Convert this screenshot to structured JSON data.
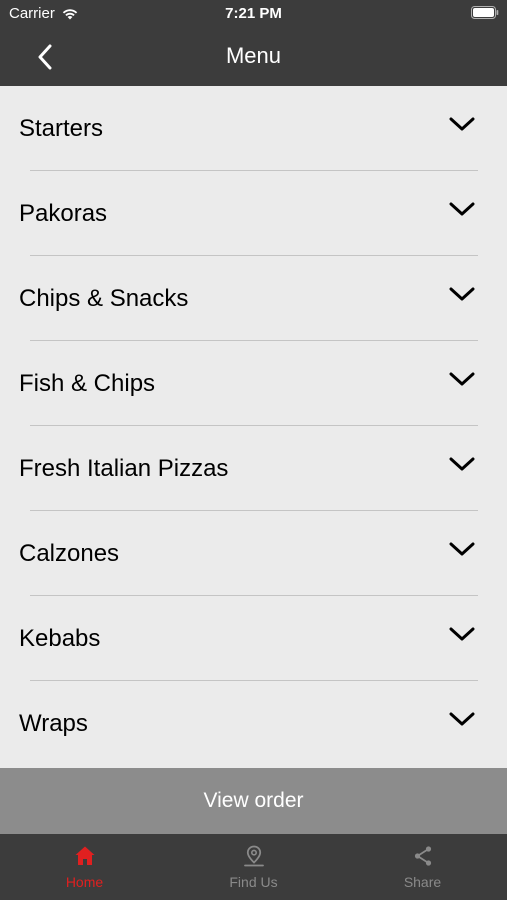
{
  "status_bar": {
    "carrier": "Carrier",
    "time": "7:21 PM",
    "wifi_icon": "wifi-icon",
    "battery_icon": "battery-icon"
  },
  "nav": {
    "title": "Menu",
    "back_icon": "chevron-left-icon"
  },
  "menu": {
    "items": [
      {
        "label": "Starters"
      },
      {
        "label": "Pakoras"
      },
      {
        "label": "Chips & Snacks"
      },
      {
        "label": "Fish & Chips"
      },
      {
        "label": "Fresh Italian Pizzas"
      },
      {
        "label": "Calzones"
      },
      {
        "label": "Kebabs"
      },
      {
        "label": "Wraps"
      }
    ],
    "expand_icon": "chevron-down-icon"
  },
  "view_order": {
    "label": "View order"
  },
  "tab_bar": {
    "tabs": [
      {
        "label": "Home",
        "icon": "home-icon",
        "active": true
      },
      {
        "label": "Find Us",
        "icon": "location-pin-icon",
        "active": false
      },
      {
        "label": "Share",
        "icon": "share-icon",
        "active": false
      }
    ]
  },
  "colors": {
    "bar_background": "#3c3c3c",
    "list_background": "#ebebeb",
    "view_order_background": "#8c8c8c",
    "active_tab": "#e02020",
    "inactive_tab": "#8a8a8a"
  }
}
